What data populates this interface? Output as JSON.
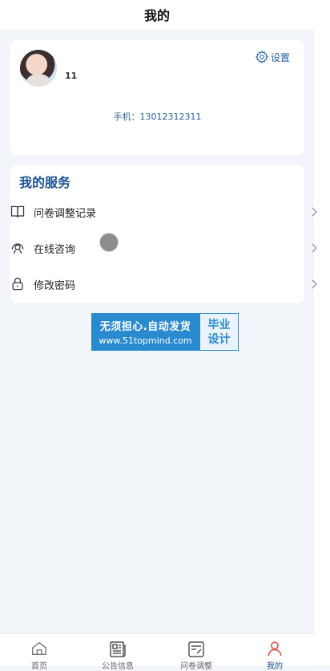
{
  "header": {
    "title": "我的"
  },
  "profile": {
    "username": "11",
    "settings_label": "设置",
    "phone": "手机：13012312311"
  },
  "services": {
    "title": "我的服务",
    "items": [
      {
        "label": "问卷调整记录",
        "icon": "book-icon"
      },
      {
        "label": "在线咨询",
        "icon": "headset-icon"
      },
      {
        "label": "修改密码",
        "icon": "lock-icon"
      }
    ]
  },
  "ad": {
    "line1": "无须担心.自动发货",
    "line2": "www.51topmind.com",
    "right_line1": "毕业",
    "right_line2": "设计"
  },
  "tabbar": {
    "items": [
      {
        "label": "首页",
        "icon": "home-icon",
        "active": false
      },
      {
        "label": "公告信息",
        "icon": "news-icon",
        "active": false
      },
      {
        "label": "问卷调整",
        "icon": "survey-icon",
        "active": false
      },
      {
        "label": "我的",
        "icon": "user-icon",
        "active": true
      }
    ]
  },
  "colors": {
    "accent": "#1a5296",
    "active_icon": "#e4584f",
    "ad_blue": "#2a8ad0"
  }
}
